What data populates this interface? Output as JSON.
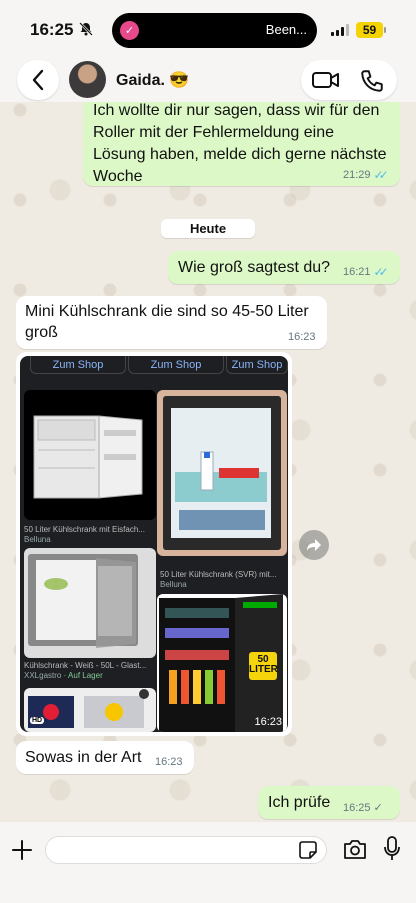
{
  "status_bar": {
    "time": "16:25",
    "activity_text": "Been...",
    "battery": "59"
  },
  "header": {
    "contact_name": "Gaida. 😎"
  },
  "messages": [
    {
      "id": "m1",
      "direction": "out",
      "text": "Ich wollte dir nur sagen, dass wir für den Roller mit der Fehlermeldung eine Lösung haben, melde dich gerne nächste Woche",
      "time": "21:29",
      "status": "read"
    },
    {
      "id": "m2",
      "direction": "out",
      "text": "Wie groß sagtest du?",
      "time": "16:21",
      "status": "read"
    },
    {
      "id": "m3",
      "direction": "in",
      "text": "Mini Kühlschrank die sind so 45-50 Liter groß",
      "time": "16:23"
    },
    {
      "id": "m4",
      "direction": "in",
      "type": "image",
      "time": "16:23"
    },
    {
      "id": "m5",
      "direction": "in",
      "text": "Sowas in der Art",
      "time": "16:23"
    },
    {
      "id": "m6",
      "direction": "out",
      "text": "Ich prüfe",
      "time": "16:25",
      "status": "sent"
    }
  ],
  "date_separator": "Heute",
  "screenshot_content": {
    "shop_buttons": [
      "Zum Shop",
      "Zum Shop",
      "Zum Shop"
    ],
    "products": [
      {
        "title": "50 Liter Kühlschrank mit Eisfach...",
        "seller": "Belluna"
      },
      {
        "title": "50 Liter Kühlschrank (SVR) mit...",
        "seller": "Belluna"
      },
      {
        "title": "Kühlschrank - Weiß - 50L - Glast...",
        "seller": "XXLgastro",
        "availability": "· Auf Lager"
      }
    ],
    "badge_text": "50\nLITER",
    "hd_badge": "HD"
  },
  "colors": {
    "outgoing_bubble": "#dcf8c6",
    "incoming_bubble": "#ffffff",
    "read_tick": "#53bdeb",
    "background": "#efeae2"
  }
}
